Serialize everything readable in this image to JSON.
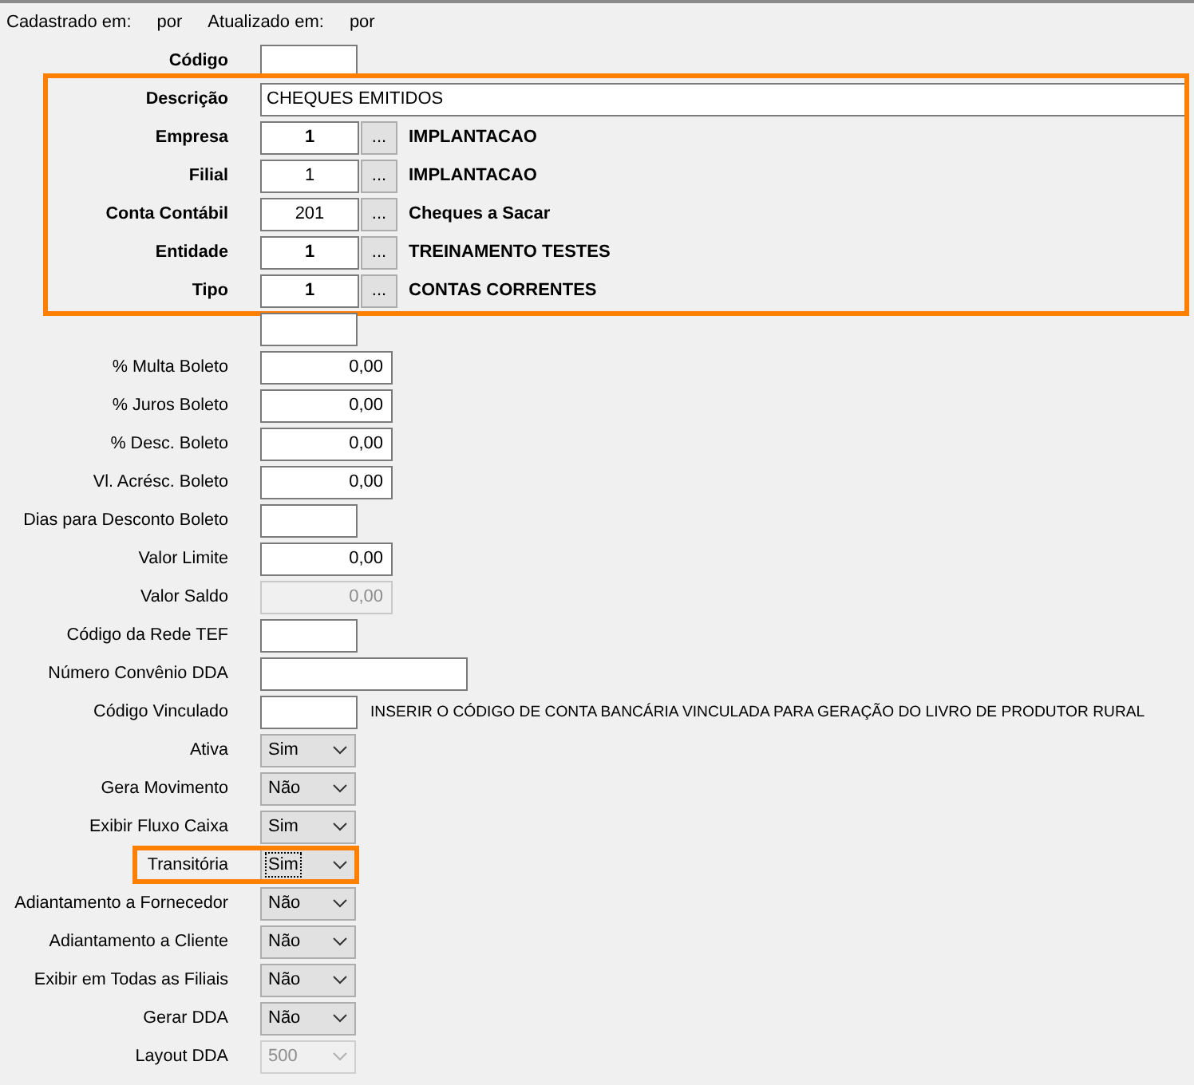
{
  "header": {
    "created_label": "Cadastrado em:",
    "created_by": "por",
    "updated_label": "Atualizado em:",
    "updated_by": "por"
  },
  "sections": [
    {
      "highlighted": false,
      "rows": [
        {
          "kind": "code",
          "label": "Código",
          "required": true
        }
      ]
    },
    {
      "highlighted": true,
      "rows": [
        {
          "kind": "text_full",
          "label": "Descrição",
          "required": true,
          "value": "CHEQUES EMITIDOS"
        },
        {
          "kind": "lookup",
          "label": "Empresa",
          "required": true,
          "code": "1",
          "code_bold": true,
          "button_label": "...",
          "name": "IMPLANTACAO"
        },
        {
          "kind": "lookup",
          "label": "Filial",
          "required": true,
          "code": "1",
          "code_bold": false,
          "button_label": "...",
          "name": "IMPLANTACAO"
        },
        {
          "kind": "lookup",
          "label": "Conta Contábil",
          "required": true,
          "code": "201",
          "code_bold": false,
          "button_label": "...",
          "name": "Cheques a Sacar"
        },
        {
          "kind": "lookup",
          "label": "Entidade",
          "required": true,
          "code": "1",
          "code_bold": true,
          "button_label": "...",
          "name": "TREINAMENTO TESTES"
        },
        {
          "kind": "lookup",
          "label": "Tipo",
          "required": true,
          "code": "1",
          "code_bold": true,
          "button_label": "...",
          "name": "CONTAS CORRENTES"
        }
      ]
    },
    {
      "highlighted": false,
      "rows": [
        {
          "kind": "code"
        },
        {
          "kind": "amount",
          "label": "% Multa Boleto",
          "required": false,
          "value": "0,00",
          "disabled": false
        },
        {
          "kind": "amount",
          "label": "% Juros Boleto",
          "required": false,
          "value": "0,00",
          "disabled": false
        },
        {
          "kind": "amount",
          "label": "% Desc. Boleto",
          "required": false,
          "value": "0,00",
          "disabled": false
        },
        {
          "kind": "amount",
          "label": "Vl. Acrésc. Boleto",
          "required": false,
          "value": "0,00",
          "disabled": false
        },
        {
          "kind": "code",
          "label": "Dias para Desconto Boleto",
          "required": false
        },
        {
          "kind": "amount",
          "label": "Valor Limite",
          "required": false,
          "value": "0,00",
          "disabled": false
        },
        {
          "kind": "amount",
          "label": "Valor Saldo",
          "required": false,
          "value": "0,00",
          "disabled": true
        },
        {
          "kind": "code",
          "label": "Código da Rede TEF",
          "required": false
        },
        {
          "kind": "text_long",
          "label": "Número Convênio DDA",
          "required": false
        },
        {
          "kind": "code",
          "label": "Código Vinculado",
          "required": false,
          "note": "INSERIR O CÓDIGO DE CONTA BANCÁRIA VINCULADA PARA GERAÇÃO DO LIVRO DE PRODUTOR RURAL"
        },
        {
          "kind": "select",
          "label": "Ativa",
          "required": false,
          "value": "Sim",
          "disabled": false,
          "focused": false,
          "highlighted": false
        },
        {
          "kind": "select",
          "label": "Gera Movimento",
          "required": false,
          "value": "Não",
          "disabled": false,
          "focused": false,
          "highlighted": false
        },
        {
          "kind": "select",
          "label": "Exibir Fluxo Caixa",
          "required": false,
          "value": "Sim",
          "disabled": false,
          "focused": false,
          "highlighted": false
        },
        {
          "kind": "select",
          "label": "Transitória",
          "required": false,
          "value": "Sim",
          "disabled": false,
          "focused": true,
          "highlighted": true
        },
        {
          "kind": "select",
          "label": "Adiantamento a Fornecedor",
          "required": false,
          "value": "Não",
          "disabled": false,
          "focused": false,
          "highlighted": false
        },
        {
          "kind": "select",
          "label": "Adiantamento a Cliente",
          "required": false,
          "value": "Não",
          "disabled": false,
          "focused": false,
          "highlighted": false
        },
        {
          "kind": "select",
          "label": "Exibir em Todas as Filiais",
          "required": false,
          "value": "Não",
          "disabled": false,
          "focused": false,
          "highlighted": false
        },
        {
          "kind": "select",
          "label": "Gerar DDA",
          "required": false,
          "value": "Não",
          "disabled": false,
          "focused": false,
          "highlighted": false
        },
        {
          "kind": "select",
          "label": "Layout DDA",
          "required": false,
          "value": "500",
          "disabled": true,
          "focused": false,
          "highlighted": false
        }
      ]
    }
  ]
}
